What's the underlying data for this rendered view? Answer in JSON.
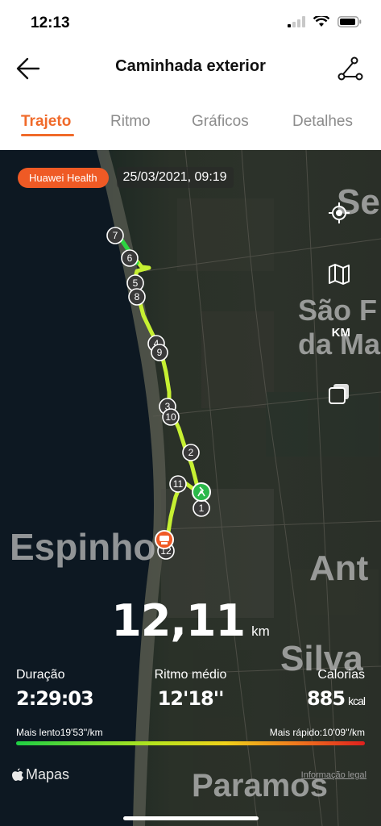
{
  "status_bar": {
    "time": "12:13"
  },
  "nav": {
    "title": "Caminhada exterior",
    "back_icon": "arrow-left-icon",
    "share_icon": "share-route-icon"
  },
  "tabs": [
    {
      "label": "Trajeto",
      "active": true
    },
    {
      "label": "Ritmo",
      "active": false
    },
    {
      "label": "Gráficos",
      "active": false
    },
    {
      "label": "Detalhes",
      "active": false
    }
  ],
  "map": {
    "source_badge": "Huawei Health",
    "datetime": "25/03/2021, 09:19",
    "place_labels": [
      "Espinho",
      "São F",
      "da Ma",
      "Se",
      "Ant",
      "Silva",
      "Paramos"
    ],
    "controls": {
      "locate_icon": "locate-icon",
      "map_icon": "map-icon",
      "unit_label": "KM",
      "layers_icon": "layers-icon"
    },
    "km_markers": [
      "7",
      "6",
      "5",
      "8",
      "4",
      "9",
      "3",
      "10",
      "2",
      "11",
      "1",
      "12"
    ],
    "colors": {
      "route_fast": "#c6f032",
      "route_slow": "#2bd642",
      "start": "#2bb84a",
      "end": "#ef5a25"
    }
  },
  "stats": {
    "distance_value": "12,11",
    "distance_unit": "km",
    "duration_label": "Duração",
    "duration_value": "2:29:03",
    "pace_label": "Ritmo médio",
    "pace_value": "12'18''",
    "calories_label": "Calorias",
    "calories_value": "885",
    "calories_unit": "kcal",
    "slowest": "Mais lento19'53''/km",
    "fastest": "Mais rápido:10'09''/km"
  },
  "footer": {
    "maps_label": "Mapas",
    "legal_label": "Informação legal"
  }
}
